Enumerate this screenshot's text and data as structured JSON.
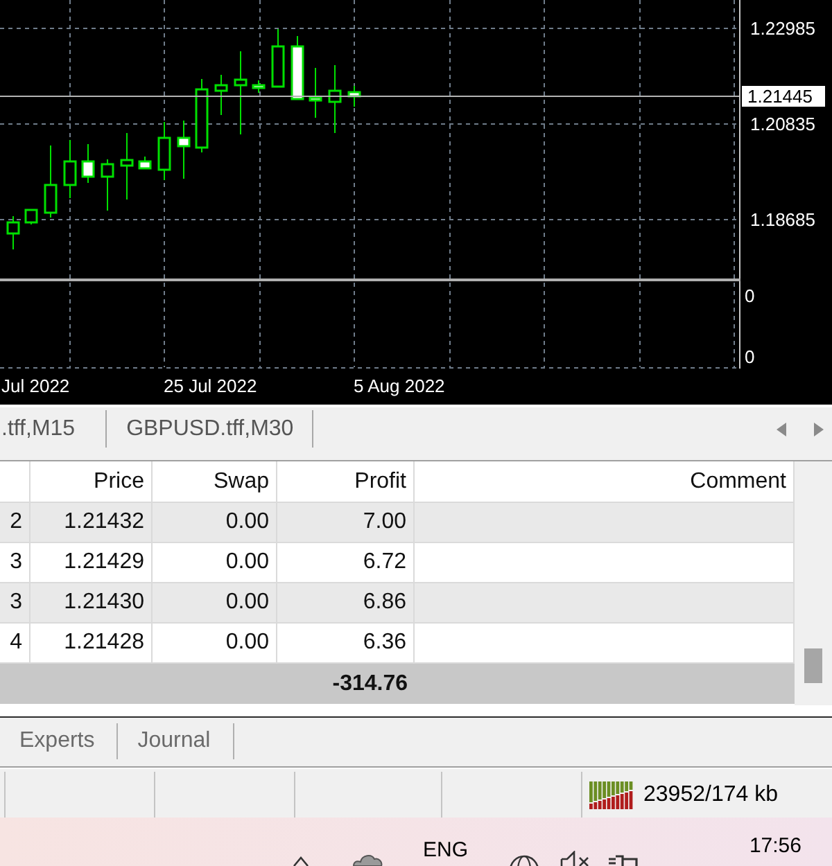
{
  "chart": {
    "price_labels": [
      "1.22985",
      "1.20835",
      "1.18685"
    ],
    "current_price": "1.21445",
    "indicator_labels": [
      "0",
      "0"
    ],
    "date_labels": [
      "Jul 2022",
      "25 Jul 2022",
      "5 Aug 2022"
    ]
  },
  "chart_tabs": [
    {
      "label": ".tff,M15",
      "selected": false
    },
    {
      "label": "GBPUSD.tff,M30",
      "selected": false
    }
  ],
  "table": {
    "columns": [
      "Price",
      "Swap",
      "Profit",
      "Comment"
    ],
    "rows": [
      {
        "column_1": "2",
        "price": "1.21432",
        "swap": "0.00",
        "profit": "7.00"
      },
      {
        "column_1": "3",
        "price": "1.21429",
        "swap": "0.00",
        "profit": "6.72"
      },
      {
        "column_1": "3",
        "price": "1.21430",
        "swap": "0.00",
        "profit": "6.86"
      },
      {
        "column_1": "4",
        "price": "1.21428",
        "swap": "0.00",
        "profit": "6.36"
      }
    ],
    "total": {
      "profit": "-314.76"
    }
  },
  "terminal_tabs": [
    {
      "label": "Experts",
      "selected": false
    },
    {
      "label": "Journal",
      "selected": false
    }
  ],
  "status_bar": {
    "traffic": "23952/174 kb"
  },
  "taskbar": {
    "language": "ENG",
    "time": "17:56"
  }
}
